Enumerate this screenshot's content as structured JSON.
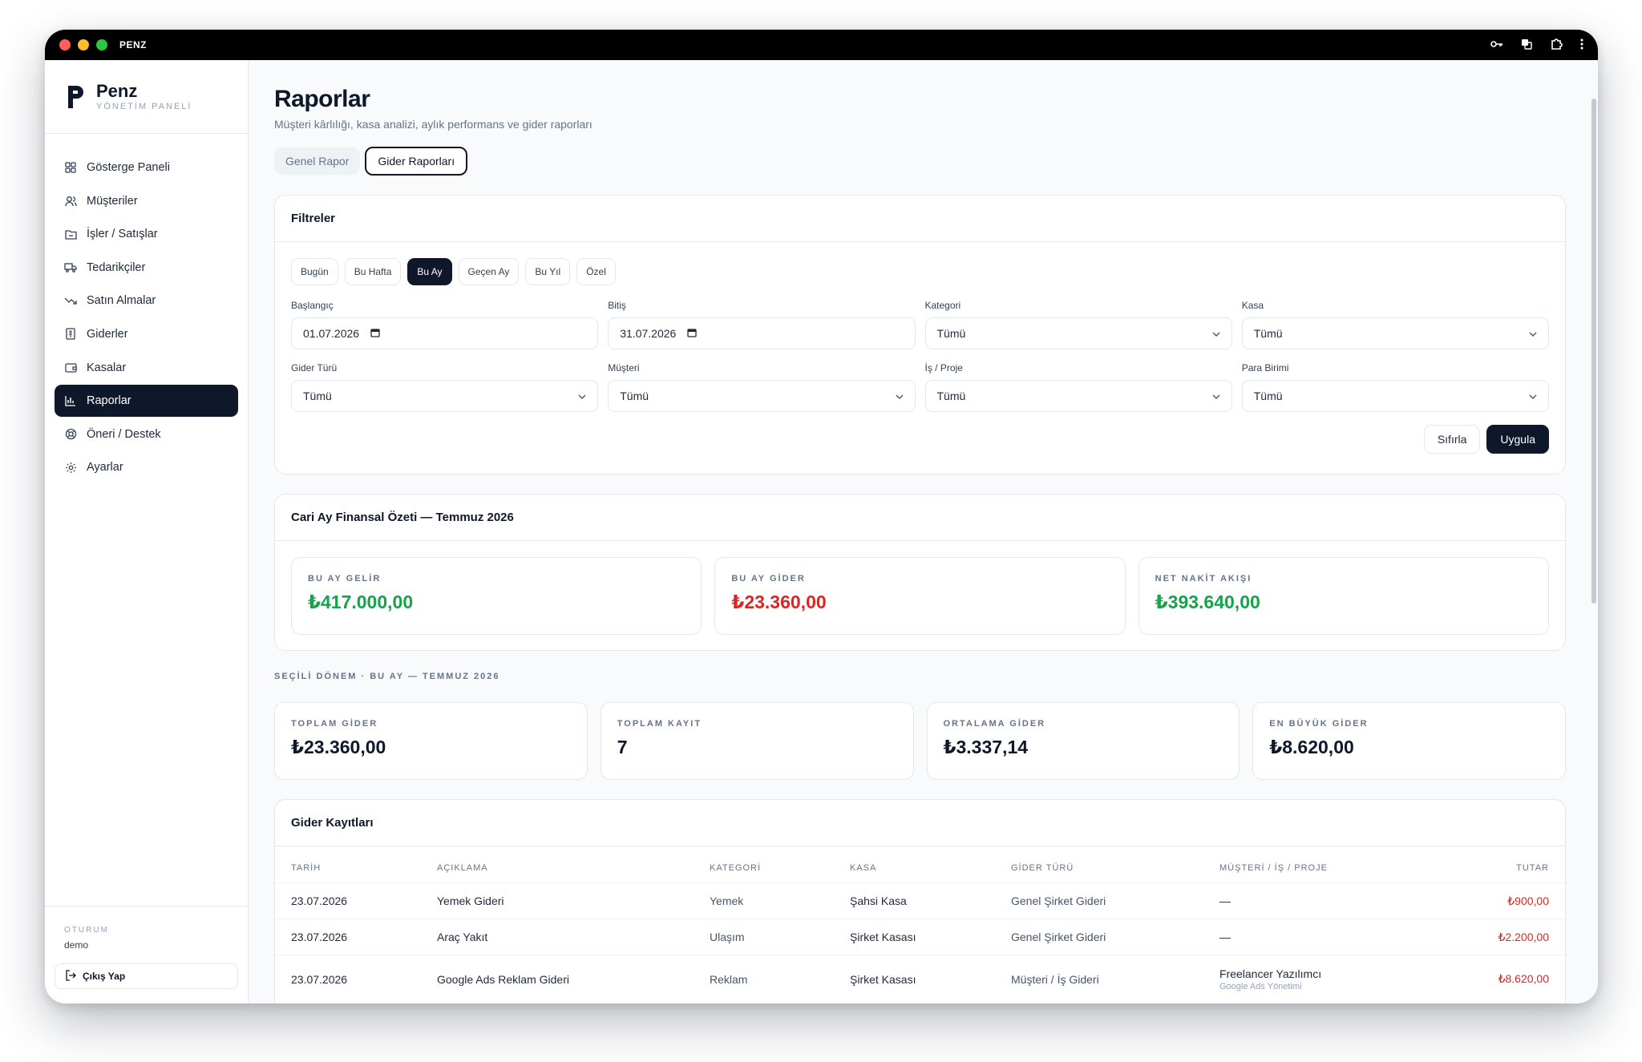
{
  "window": {
    "title": "PENZ"
  },
  "brand": {
    "name": "Penz",
    "subtitle": "YÖNETİM PANELİ"
  },
  "sidebar": {
    "items": [
      {
        "label": "Gösterge Paneli",
        "icon": "dashboard-icon"
      },
      {
        "label": "Müşteriler",
        "icon": "users-icon"
      },
      {
        "label": "İşler / Satışlar",
        "icon": "folder-icon"
      },
      {
        "label": "Tedarikçiler",
        "icon": "truck-icon"
      },
      {
        "label": "Satın Almalar",
        "icon": "trend-down-icon"
      },
      {
        "label": "Giderler",
        "icon": "receipt-icon"
      },
      {
        "label": "Kasalar",
        "icon": "wallet-icon"
      },
      {
        "label": "Raporlar",
        "icon": "chart-icon",
        "active": true
      },
      {
        "label": "Öneri / Destek",
        "icon": "lifebuoy-icon"
      },
      {
        "label": "Ayarlar",
        "icon": "gear-icon"
      }
    ],
    "session_label": "OTURUM",
    "session_user": "demo",
    "logout_label": "Çıkış Yap"
  },
  "page": {
    "title": "Raporlar",
    "subtitle": "Müşteri kârlılığı, kasa analizi, aylık performans ve gider raporları",
    "tabs": [
      {
        "label": "Genel Rapor",
        "active": false
      },
      {
        "label": "Gider Raporları",
        "active": true
      }
    ]
  },
  "filters": {
    "title": "Filtreler",
    "presets": [
      {
        "label": "Bugün",
        "active": false
      },
      {
        "label": "Bu Hafta",
        "active": false
      },
      {
        "label": "Bu Ay",
        "active": true
      },
      {
        "label": "Geçen Ay",
        "active": false
      },
      {
        "label": "Bu Yıl",
        "active": false
      },
      {
        "label": "Özel",
        "active": false
      }
    ],
    "start_label": "Başlangıç",
    "start_value": "01.07.2026",
    "end_label": "Bitiş",
    "end_value": "31.07.2026",
    "category_label": "Kategori",
    "category_value": "Tümü",
    "cashbox_label": "Kasa",
    "cashbox_value": "Tümü",
    "expense_type_label": "Gider Türü",
    "expense_type_value": "Tümü",
    "customer_label": "Müşteri",
    "customer_value": "Tümü",
    "project_label": "İş / Proje",
    "project_value": "Tümü",
    "currency_label": "Para Birimi",
    "currency_value": "Tümü",
    "reset_label": "Sıfırla",
    "apply_label": "Uygula"
  },
  "summary": {
    "title": "Cari Ay Finansal Özeti — Temmuz 2026",
    "income_label": "BU AY GELİR",
    "income_value": "₺417.000,00",
    "expense_label": "BU AY GİDER",
    "expense_value": "₺23.360,00",
    "net_label": "NET NAKİT AKIŞI",
    "net_value": "₺393.640,00"
  },
  "period": {
    "label": "SEÇİLİ DÖNEM · BU AY — TEMMUZ 2026",
    "total_expense_label": "TOPLAM GİDER",
    "total_expense_value": "₺23.360,00",
    "total_records_label": "TOPLAM KAYIT",
    "total_records_value": "7",
    "avg_expense_label": "ORTALAMA GİDER",
    "avg_expense_value": "₺3.337,14",
    "max_expense_label": "EN BÜYÜK GİDER",
    "max_expense_value": "₺8.620,00"
  },
  "records": {
    "title": "Gider Kayıtları",
    "columns": [
      "TARİH",
      "AÇIKLAMA",
      "KATEGORİ",
      "KASA",
      "GİDER TÜRÜ",
      "MÜŞTERİ / İŞ / PROJE",
      "TUTAR"
    ],
    "rows": [
      {
        "date": "23.07.2026",
        "desc": "Yemek Gideri",
        "category": "Yemek",
        "cashbox": "Şahsi Kasa",
        "type": "Genel Şirket Gideri",
        "customer": "—",
        "customer_sub": "",
        "amount": "₺900,00"
      },
      {
        "date": "23.07.2026",
        "desc": "Araç Yakıt",
        "category": "Ulaşım",
        "cashbox": "Şirket Kasası",
        "type": "Genel Şirket Gideri",
        "customer": "—",
        "customer_sub": "",
        "amount": "₺2.200,00"
      },
      {
        "date": "23.07.2026",
        "desc": "Google Ads Reklam Gideri",
        "category": "Reklam",
        "cashbox": "Şirket Kasası",
        "type": "Müşteri / İş Gideri",
        "customer": "Freelancer Yazılımcı",
        "customer_sub": "Google Ads Yönetimi",
        "amount": "₺8.620,00"
      }
    ]
  },
  "colors": {
    "accent": "#0f172a",
    "positive": "#16a34a",
    "negative": "#dc2626"
  }
}
